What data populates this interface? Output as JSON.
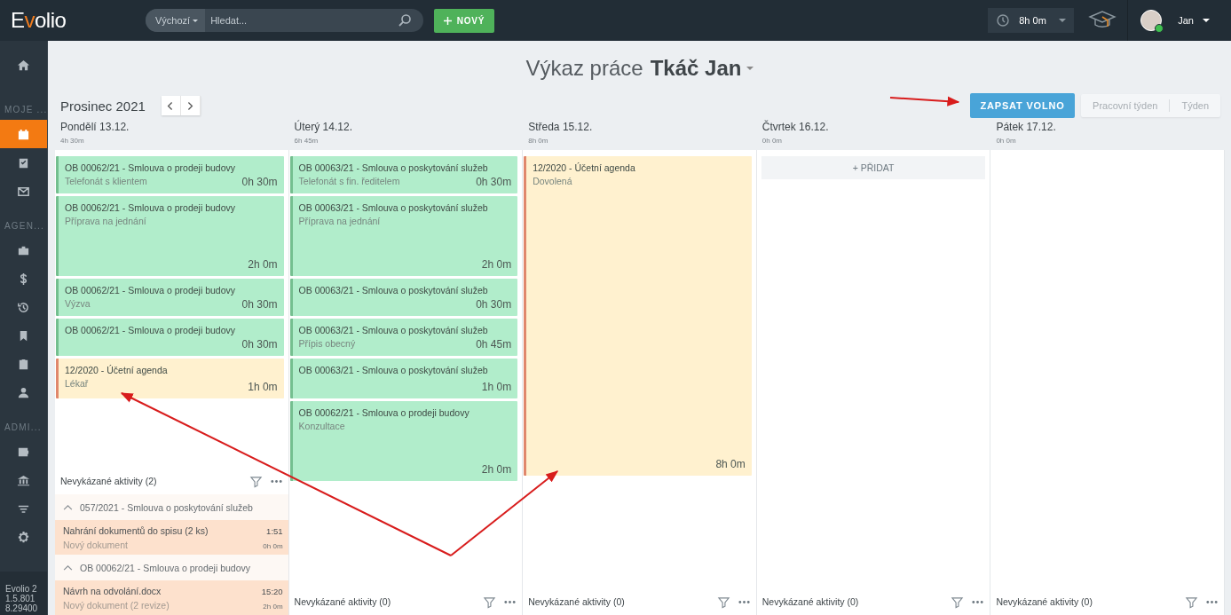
{
  "topbar": {
    "logo": "Evolio",
    "search": {
      "scope": "Výchozí",
      "placeholder": "Hledat..."
    },
    "new_button": "NOVÝ",
    "timer": "8h 0m",
    "user": "Jan",
    "user_online": true
  },
  "sidebar": {
    "items": [
      {
        "kind": "item",
        "selected": false
      },
      {
        "kind": "section",
        "label": "MOJE ..."
      },
      {
        "kind": "item",
        "selected": true
      },
      {
        "kind": "item",
        "selected": false
      },
      {
        "kind": "item",
        "selected": false
      },
      {
        "kind": "section",
        "label": "AGEN..."
      },
      {
        "kind": "item",
        "selected": false
      },
      {
        "kind": "item",
        "selected": false
      },
      {
        "kind": "item",
        "selected": false
      },
      {
        "kind": "item",
        "selected": false
      },
      {
        "kind": "item",
        "selected": false
      },
      {
        "kind": "item",
        "selected": false
      },
      {
        "kind": "section",
        "label": "ADMI..."
      },
      {
        "kind": "item",
        "selected": false
      },
      {
        "kind": "item",
        "selected": false
      },
      {
        "kind": "item",
        "selected": false
      },
      {
        "kind": "item",
        "selected": false
      }
    ],
    "version": [
      "Evolio 2",
      "1.5.801",
      "8.29400"
    ]
  },
  "header": {
    "title": "Výkaz práce",
    "person": "Tkáč Jan",
    "month": "Prosinec 2021",
    "leave_button": "ZAPSAT VOLNO",
    "views": [
      {
        "label": "Pracovní týden",
        "selected": false
      },
      {
        "label": "Týden",
        "selected": false
      }
    ]
  },
  "days": [
    {
      "name": "Pondělí 13.12.",
      "total": "4h 30m",
      "entries": [
        {
          "kind": "work",
          "title": "OB 00062/21 - Smlouva o prodeji budovy",
          "activity": "Telefonát s klientem",
          "duration": "0h 30m"
        },
        {
          "kind": "work",
          "title": "OB 00062/21 - Smlouva o prodeji budovy",
          "activity": "Příprava na jednání",
          "duration": "2h 0m"
        },
        {
          "kind": "work",
          "title": "OB 00062/21 - Smlouva o prodeji budovy",
          "activity": "Výzva",
          "duration": "0h 30m"
        },
        {
          "kind": "work",
          "title": "OB 00062/21 - Smlouva o prodeji budovy",
          "duration": "0h 30m"
        },
        {
          "kind": "absence",
          "title": "12/2020 - Účetní agenda",
          "activity": "Lékař",
          "duration": "1h 0m"
        }
      ],
      "unreported": {
        "label": "Nevykázané aktivity (2)",
        "groups": [
          {
            "title": "057/2021 - Smlouva o poskytování služeb",
            "expanded": true,
            "items": [
              {
                "name": "Nahrání dokumentů do spisu (2 ks)",
                "time": "1:51",
                "detail": "Nový dokument",
                "duration": "0h 0m"
              }
            ]
          },
          {
            "title": "OB 00062/21 - Smlouva o prodeji budovy",
            "expanded": true,
            "items": [
              {
                "name": "Návrh na odvolání.docx",
                "time": "15:20",
                "detail": "Nový dokument (2 revize)",
                "duration": "2h 0m"
              }
            ]
          }
        ]
      }
    },
    {
      "name": "Úterý 14.12.",
      "total": "6h 45m",
      "entries": [
        {
          "kind": "work",
          "title": "OB 00063/21 - Smlouva o poskytování služeb",
          "activity": "Telefonát s fin. ředitelem",
          "duration": "0h 30m"
        },
        {
          "kind": "work",
          "title": "OB 00063/21 - Smlouva o poskytování služeb",
          "activity": "Příprava na jednání",
          "duration": "2h 0m"
        },
        {
          "kind": "work",
          "title": "OB 00063/21 - Smlouva o poskytování služeb",
          "duration": "0h 30m"
        },
        {
          "kind": "work",
          "title": "OB 00063/21 - Smlouva o poskytování služeb",
          "activity": "Přípis obecný",
          "duration": "0h 45m"
        },
        {
          "kind": "work",
          "title": "OB 00063/21 - Smlouva o poskytování služeb",
          "duration": "1h 0m"
        },
        {
          "kind": "work",
          "title": "OB 00062/21 - Smlouva o prodeji budovy",
          "activity": "Konzultace",
          "duration": "2h 0m"
        }
      ],
      "unreported": {
        "label": "Nevykázané aktivity (0)"
      }
    },
    {
      "name": "Středa 15.12.",
      "total": "8h 0m",
      "entries": [
        {
          "kind": "absence",
          "title": "12/2020 - Účetní agenda",
          "activity": "Dovolená",
          "duration": "8h 0m"
        }
      ],
      "unreported": {
        "label": "Nevykázané aktivity (0)"
      }
    },
    {
      "name": "Čtvrtek 16.12.",
      "total": "0h 0m",
      "add_button": "+ PŘIDAT",
      "unreported": {
        "label": "Nevykázané aktivity (0)"
      }
    },
    {
      "name": "Pátek 17.12.",
      "total": "0h 0m",
      "unreported": {
        "label": "Nevykázané aktivity (0)"
      }
    }
  ]
}
